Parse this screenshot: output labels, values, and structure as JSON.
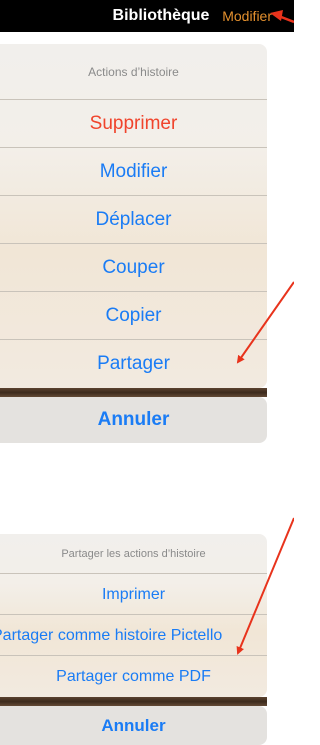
{
  "navbar": {
    "title": "Bibliothèque",
    "edit_label": "Modifier"
  },
  "story_actions": {
    "header": "Actions d’histoire",
    "items": [
      "Supprimer",
      "Modifier",
      "Déplacer",
      "Couper",
      "Copier",
      "Partager"
    ],
    "cancel_label": "Annuler"
  },
  "share_actions": {
    "header": "Partager les actions d’histoire",
    "items": [
      "Imprimer",
      "Partager comme histoire Pictello",
      "Partager comme PDF"
    ],
    "cancel_label": "Annuler"
  },
  "colors": {
    "accent": "#1a7cf5",
    "destructive": "#f0442c",
    "nav_edit": "#e3902e",
    "annotation_arrow": "#e8331c"
  }
}
